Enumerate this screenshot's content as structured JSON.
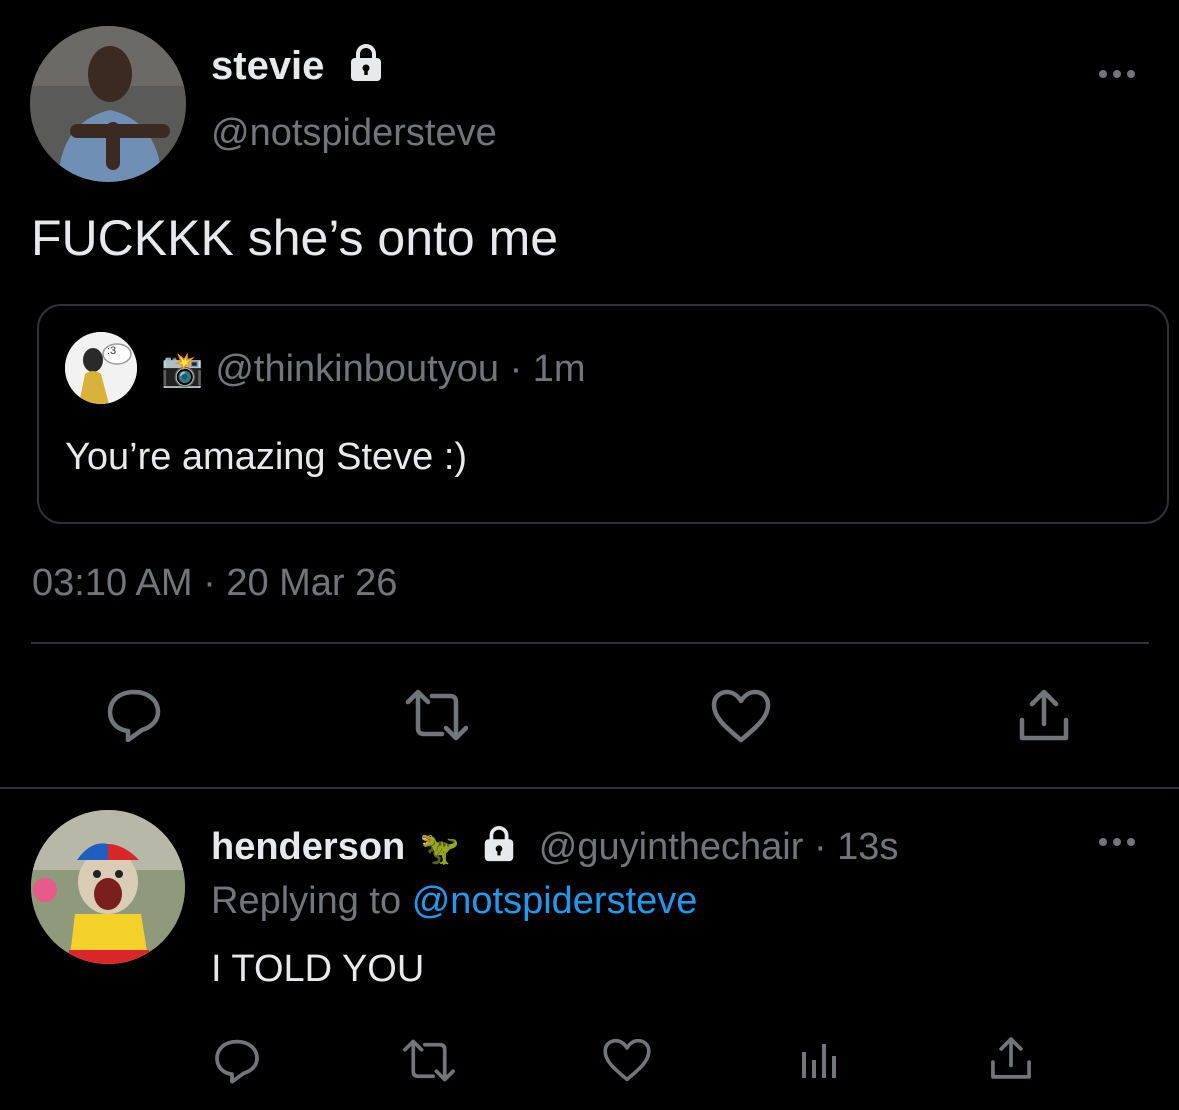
{
  "main_tweet": {
    "display_name": "stevie",
    "handle": "@notspidersteve",
    "text": "FUCKKK she’s onto me",
    "timestamp": "03:10 AM · 20 Mar 26",
    "avatar_icon": "person-avatar",
    "more_icon": "more-dots-icon"
  },
  "quoted_tweet": {
    "avatar_badge": ":3",
    "emoji": "📸",
    "handle": "@thinkinboutyou",
    "dot": "·",
    "time": "1m",
    "text": "You’re amazing Steve :)"
  },
  "reply": {
    "display_name": "henderson",
    "emoji": "🦖",
    "handle": "@guyinthechair",
    "dot": "·",
    "time": "13s",
    "replying_prefix": "Replying to",
    "replying_handle": "@notspidersteve",
    "text": "I TOLD YOU"
  },
  "colors": {
    "background": "#000000",
    "text_primary": "#e7e9ea",
    "text_secondary": "#71767b",
    "accent": "#1d9bf0",
    "border": "#2f3336"
  }
}
